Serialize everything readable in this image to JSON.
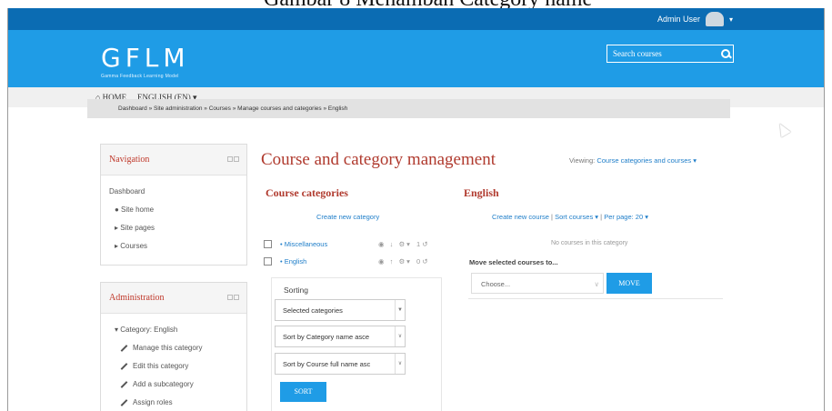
{
  "caption": "Gambar 8 Menambah Category name",
  "topbar": {
    "user_name": "Admin User",
    "caret": "▾"
  },
  "banner": {
    "logo": "GFLM",
    "logo_sub": "Gamma Feedback Learning Model",
    "search_placeholder": "Search courses"
  },
  "navbar": {
    "home": "⌂ HOME",
    "language": "ENGLISH (EN) ▾"
  },
  "breadcrumb": "Dashboard  »  Site administration  »  Courses  »  Manage courses and categories  »  English",
  "navigation_block": {
    "title": "Navigation",
    "items": [
      "Dashboard",
      "●  Site home",
      "▸  Site pages",
      "▸  Courses"
    ]
  },
  "administration_block": {
    "title": "Administration",
    "category": "▾  Category: English",
    "items": [
      "Manage this category",
      "Edit this category",
      "Add a subcategory",
      "Assign roles"
    ]
  },
  "main": {
    "title": "Course and category management",
    "viewing_label": "Viewing:",
    "viewing_value": "Course categories and courses ▾",
    "categories_title": "Course categories",
    "create_category": "Create new category",
    "categories": [
      {
        "name": "• Miscellaneous",
        "actions": "◉ ↓ ⚙▾",
        "count": "1 ↺"
      },
      {
        "name": "• English",
        "actions": "◉ ↑ ⚙▾",
        "count": "0 ↺"
      }
    ],
    "english_title": "English",
    "create_course": "Create new course",
    "sort_courses": "Sort courses ▾",
    "per_page": "Per page: 20 ▾",
    "separator": "|",
    "no_courses": "No courses in this category",
    "move_label": "Move selected courses to...",
    "choose": "Choose...",
    "move_button": "MOVE",
    "sorting_label": "Sorting",
    "sort_selects": [
      "Selected categories",
      "Sort by Category name asce",
      "Sort by Course full name asc"
    ],
    "sort_button": "SORT"
  },
  "colors": {
    "topbar": "#0b6cb3",
    "banner": "#1f9ce6",
    "accent_red": "#b03a2e",
    "link": "#1f7ec9"
  }
}
